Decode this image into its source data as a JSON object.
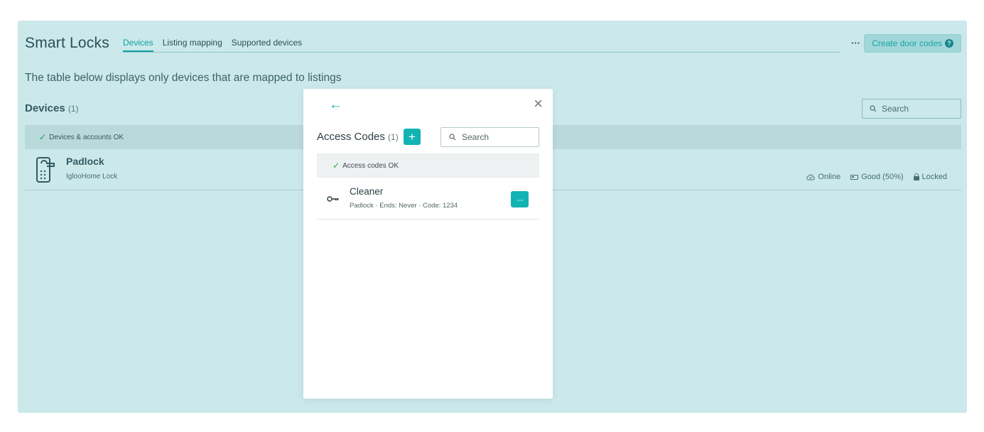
{
  "header": {
    "title": "Smart Locks",
    "tabs": [
      {
        "label": "Devices",
        "active": true
      },
      {
        "label": "Listing mapping",
        "active": false
      },
      {
        "label": "Supported devices",
        "active": false
      }
    ],
    "more_label": "···",
    "create_button_label": "Create door codes",
    "help_icon": "?"
  },
  "main": {
    "description": "The table below displays only devices that are mapped to listings",
    "devices_title": "Devices",
    "devices_count": "(1)",
    "search_placeholder": "Search",
    "status_text": "Devices & accounts OK",
    "devices": [
      {
        "name": "Padlock",
        "type": "IglooHome Lock",
        "connectivity": "Online",
        "battery": "Good (50%)",
        "lock_state": "Locked"
      }
    ]
  },
  "modal": {
    "title": "Access Codes",
    "count": "(1)",
    "add_label": "+",
    "search_placeholder": "Search",
    "status_text": "Access codes OK",
    "codes": [
      {
        "name": "Cleaner",
        "details": "Padlock · Ends: Never · Code: 1234",
        "actions_label": "···"
      }
    ]
  },
  "colors": {
    "accent": "#13b3b3",
    "overlay": "#cde8ea",
    "status_ok": "#26a33a"
  },
  "icons": {
    "back": "arrow-left-icon",
    "close": "close-icon",
    "search": "search-icon",
    "check": "check-icon",
    "key": "key-icon",
    "lock_device": "smart-lock-icon",
    "online": "cloud-check-icon",
    "battery": "battery-icon",
    "locked": "padlock-icon"
  }
}
